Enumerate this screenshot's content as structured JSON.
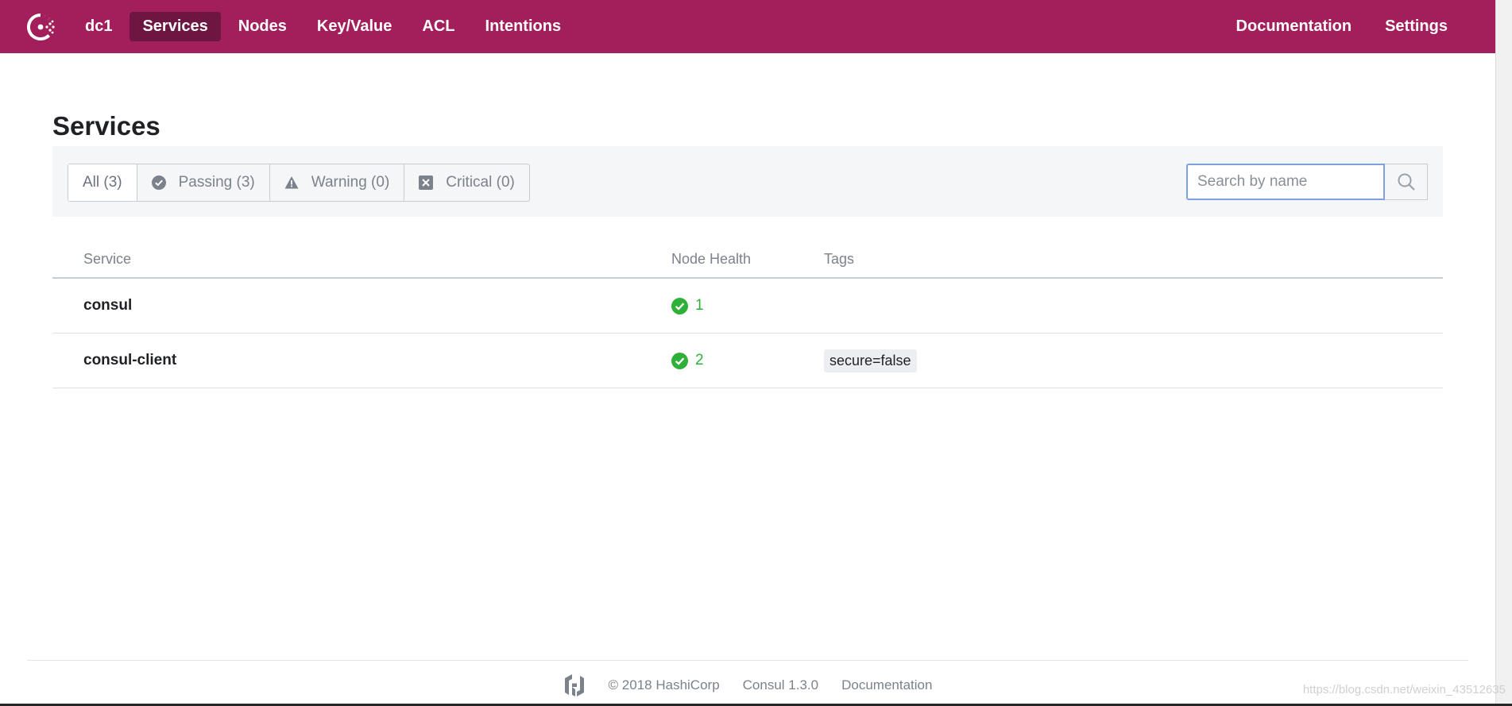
{
  "nav": {
    "datacenter": "dc1",
    "items": [
      {
        "label": "Services",
        "active": true
      },
      {
        "label": "Nodes",
        "active": false
      },
      {
        "label": "Key/Value",
        "active": false
      },
      {
        "label": "ACL",
        "active": false
      },
      {
        "label": "Intentions",
        "active": false
      }
    ],
    "right": [
      {
        "label": "Documentation"
      },
      {
        "label": "Settings"
      }
    ],
    "brand_color": "#a31f5c"
  },
  "page": {
    "title": "Services"
  },
  "filters": {
    "all": "All (3)",
    "passing": "Passing (3)",
    "warning": "Warning (0)",
    "critical": "Critical (0)",
    "selected": "all"
  },
  "search": {
    "placeholder": "Search by name",
    "value": ""
  },
  "table": {
    "columns": [
      "Service",
      "Node Health",
      "Tags"
    ],
    "rows": [
      {
        "service": "consul",
        "health": "1",
        "tags": []
      },
      {
        "service": "consul-client",
        "health": "2",
        "tags": [
          "secure=false"
        ]
      }
    ]
  },
  "footer": {
    "copyright": "© 2018 HashiCorp",
    "version": "Consul 1.3.0",
    "docs": "Documentation"
  },
  "watermark": "https://blog.csdn.net/weixin_43512635"
}
